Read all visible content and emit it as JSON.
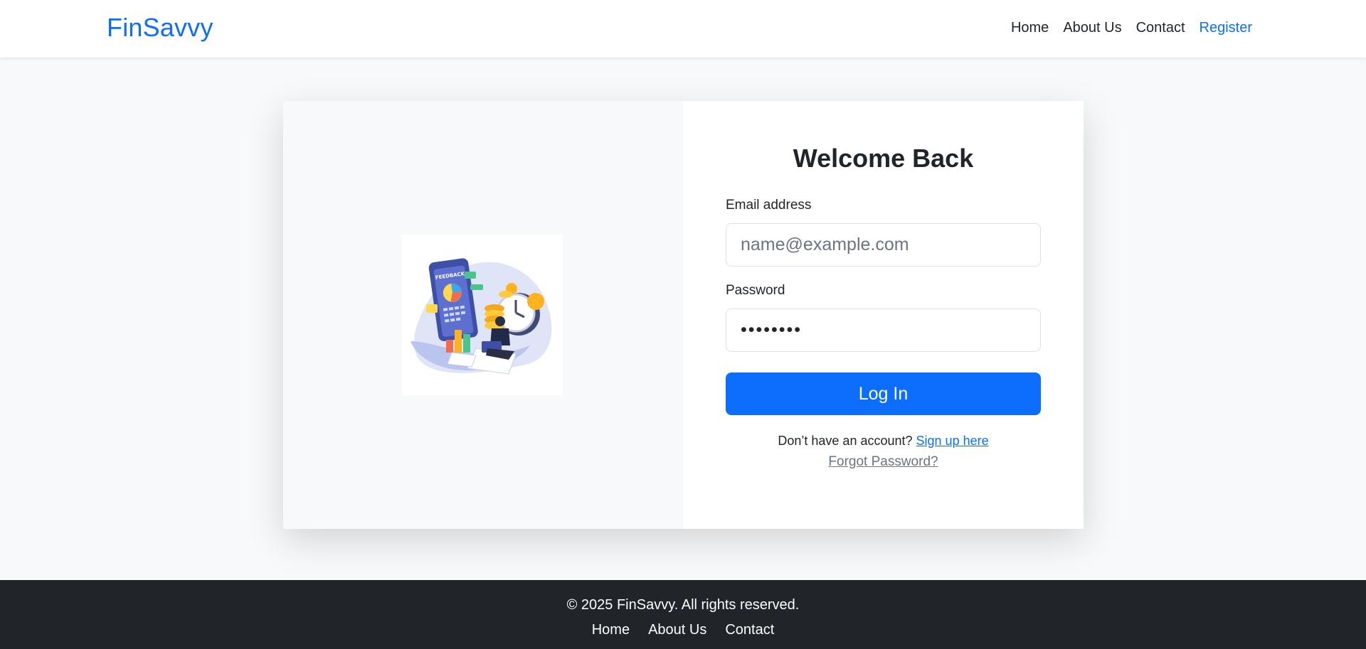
{
  "navbar": {
    "brand": "FinSavvy",
    "links": [
      {
        "label": "Home"
      },
      {
        "label": "About Us"
      },
      {
        "label": "Contact"
      },
      {
        "label": "Register",
        "active": true
      }
    ]
  },
  "login": {
    "title": "Welcome Back",
    "email_label": "Email address",
    "email_placeholder": "name@example.com",
    "email_value": "",
    "password_label": "Password",
    "password_value": "password",
    "login_button": "Log In",
    "signup_prompt": "Don’t have an account?",
    "signup_link": "Sign up here",
    "forgot_link": "Forgot Password?"
  },
  "illustration": {
    "icon": "finance-feedback-illustration",
    "text": "FEEDBACK"
  },
  "footer": {
    "copyright": "© 2025 FinSavvy. All rights reserved.",
    "links": [
      {
        "label": "Home"
      },
      {
        "label": "About Us"
      },
      {
        "label": "Contact"
      }
    ]
  },
  "colors": {
    "primary": "#0d6efd",
    "dark": "#212529",
    "light_bg": "#f8f9fa",
    "muted": "#6c757d"
  }
}
